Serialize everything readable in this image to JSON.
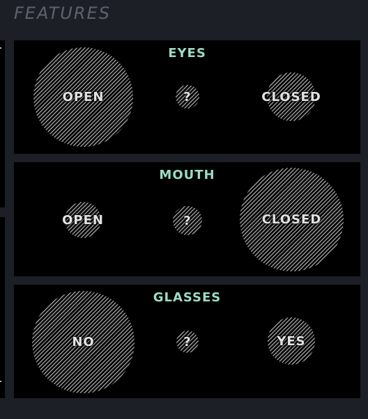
{
  "header": {
    "title": "FEATURES"
  },
  "panels": [
    {
      "title": "EYES",
      "options": [
        {
          "label": "OPEN",
          "weight": 1.0
        },
        {
          "label": "?",
          "weight": 0.06
        },
        {
          "label": "CLOSED",
          "weight": 0.24
        }
      ]
    },
    {
      "title": "MOUTH",
      "options": [
        {
          "label": "OPEN",
          "weight": 0.13
        },
        {
          "label": "?",
          "weight": 0.08
        },
        {
          "label": "CLOSED",
          "weight": 1.0
        }
      ]
    },
    {
      "title": "GLASSES",
      "options": [
        {
          "label": "NO",
          "weight": 1.0
        },
        {
          "label": "?",
          "weight": 0.04
        },
        {
          "label": "YES",
          "weight": 0.21
        }
      ]
    }
  ]
}
